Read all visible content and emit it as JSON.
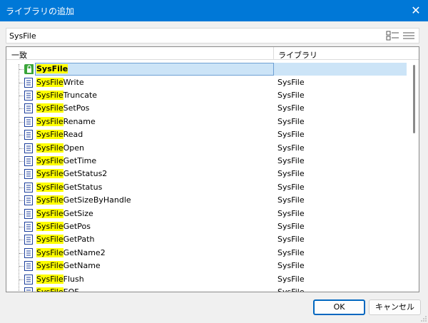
{
  "window": {
    "title": "ライブラリの追加",
    "close_glyph": "✕"
  },
  "search": {
    "value": "SysFile"
  },
  "columns": {
    "name": "一致",
    "library": "ライブラリ"
  },
  "selected": {
    "match": "SysFile",
    "rest": "",
    "library": ""
  },
  "rows": [
    {
      "match": "SysFile",
      "rest": "Write",
      "library": "SysFile"
    },
    {
      "match": "SysFile",
      "rest": "Truncate",
      "library": "SysFile"
    },
    {
      "match": "SysFile",
      "rest": "SetPos",
      "library": "SysFile"
    },
    {
      "match": "SysFile",
      "rest": "Rename",
      "library": "SysFile"
    },
    {
      "match": "SysFile",
      "rest": "Read",
      "library": "SysFile"
    },
    {
      "match": "SysFile",
      "rest": "Open",
      "library": "SysFile"
    },
    {
      "match": "SysFile",
      "rest": "GetTime",
      "library": "SysFile"
    },
    {
      "match": "SysFile",
      "rest": "GetStatus2",
      "library": "SysFile"
    },
    {
      "match": "SysFile",
      "rest": "GetStatus",
      "library": "SysFile"
    },
    {
      "match": "SysFile",
      "rest": "GetSizeByHandle",
      "library": "SysFile"
    },
    {
      "match": "SysFile",
      "rest": "GetSize",
      "library": "SysFile"
    },
    {
      "match": "SysFile",
      "rest": "GetPos",
      "library": "SysFile"
    },
    {
      "match": "SysFile",
      "rest": "GetPath",
      "library": "SysFile"
    },
    {
      "match": "SysFile",
      "rest": "GetName2",
      "library": "SysFile"
    },
    {
      "match": "SysFile",
      "rest": "GetName",
      "library": "SysFile"
    },
    {
      "match": "SysFile",
      "rest": "Flush",
      "library": "SysFile"
    },
    {
      "match": "SysFile",
      "rest": "EOF",
      "library": "SysFile"
    }
  ],
  "buttons": {
    "ok": "OK",
    "cancel": "キャンセル"
  },
  "colors": {
    "titlebar": "#0078d7",
    "match_highlight": "#ffff00",
    "selection": "#cce4f7"
  },
  "icons": {
    "root": "library-lock-icon",
    "item": "function-document-icon"
  }
}
